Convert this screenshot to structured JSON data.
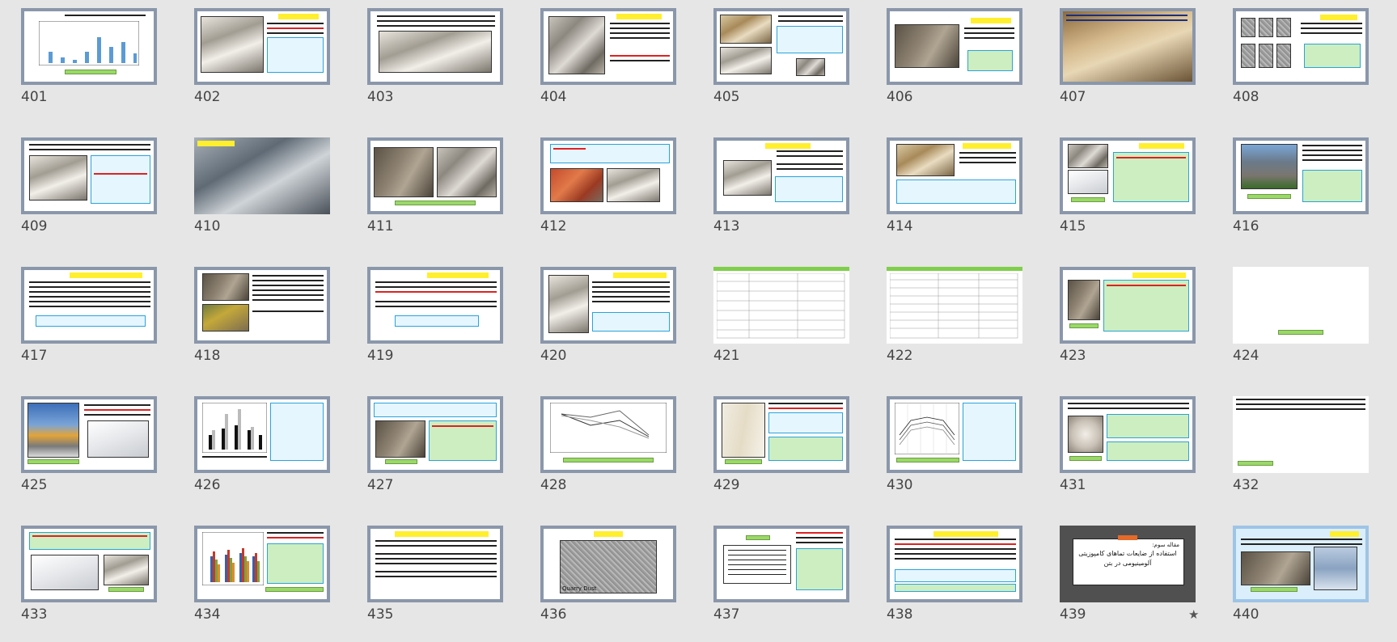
{
  "slides": [
    {
      "n": "401"
    },
    {
      "n": "402"
    },
    {
      "n": "403"
    },
    {
      "n": "404"
    },
    {
      "n": "405"
    },
    {
      "n": "406"
    },
    {
      "n": "407"
    },
    {
      "n": "408"
    },
    {
      "n": "409"
    },
    {
      "n": "410"
    },
    {
      "n": "411"
    },
    {
      "n": "412"
    },
    {
      "n": "413"
    },
    {
      "n": "414"
    },
    {
      "n": "415"
    },
    {
      "n": "416"
    },
    {
      "n": "417"
    },
    {
      "n": "418"
    },
    {
      "n": "419"
    },
    {
      "n": "420"
    },
    {
      "n": "421"
    },
    {
      "n": "422"
    },
    {
      "n": "423"
    },
    {
      "n": "424"
    },
    {
      "n": "425"
    },
    {
      "n": "426"
    },
    {
      "n": "427"
    },
    {
      "n": "428"
    },
    {
      "n": "429"
    },
    {
      "n": "430"
    },
    {
      "n": "431"
    },
    {
      "n": "432"
    },
    {
      "n": "433"
    },
    {
      "n": "434"
    },
    {
      "n": "435"
    },
    {
      "n": "436"
    },
    {
      "n": "437"
    },
    {
      "n": "438"
    },
    {
      "n": "439"
    },
    {
      "n": "440"
    }
  ],
  "slide_436_caption": "Quarry Dust",
  "slide_439_title_line1": "استفاده از ضایعات تماهای کامپوزیتی",
  "slide_439_title_line2": "آلومینیومی در بتن",
  "slide_439_label": "مقاله سوم:",
  "slide_439_star": "★",
  "colors": {
    "background": "#e6e6e6",
    "frame": "#8a97ab",
    "title_bar": "#ffef2e",
    "caption_bar": "#9bd86a",
    "text_box_border": "#2aa3d9"
  }
}
